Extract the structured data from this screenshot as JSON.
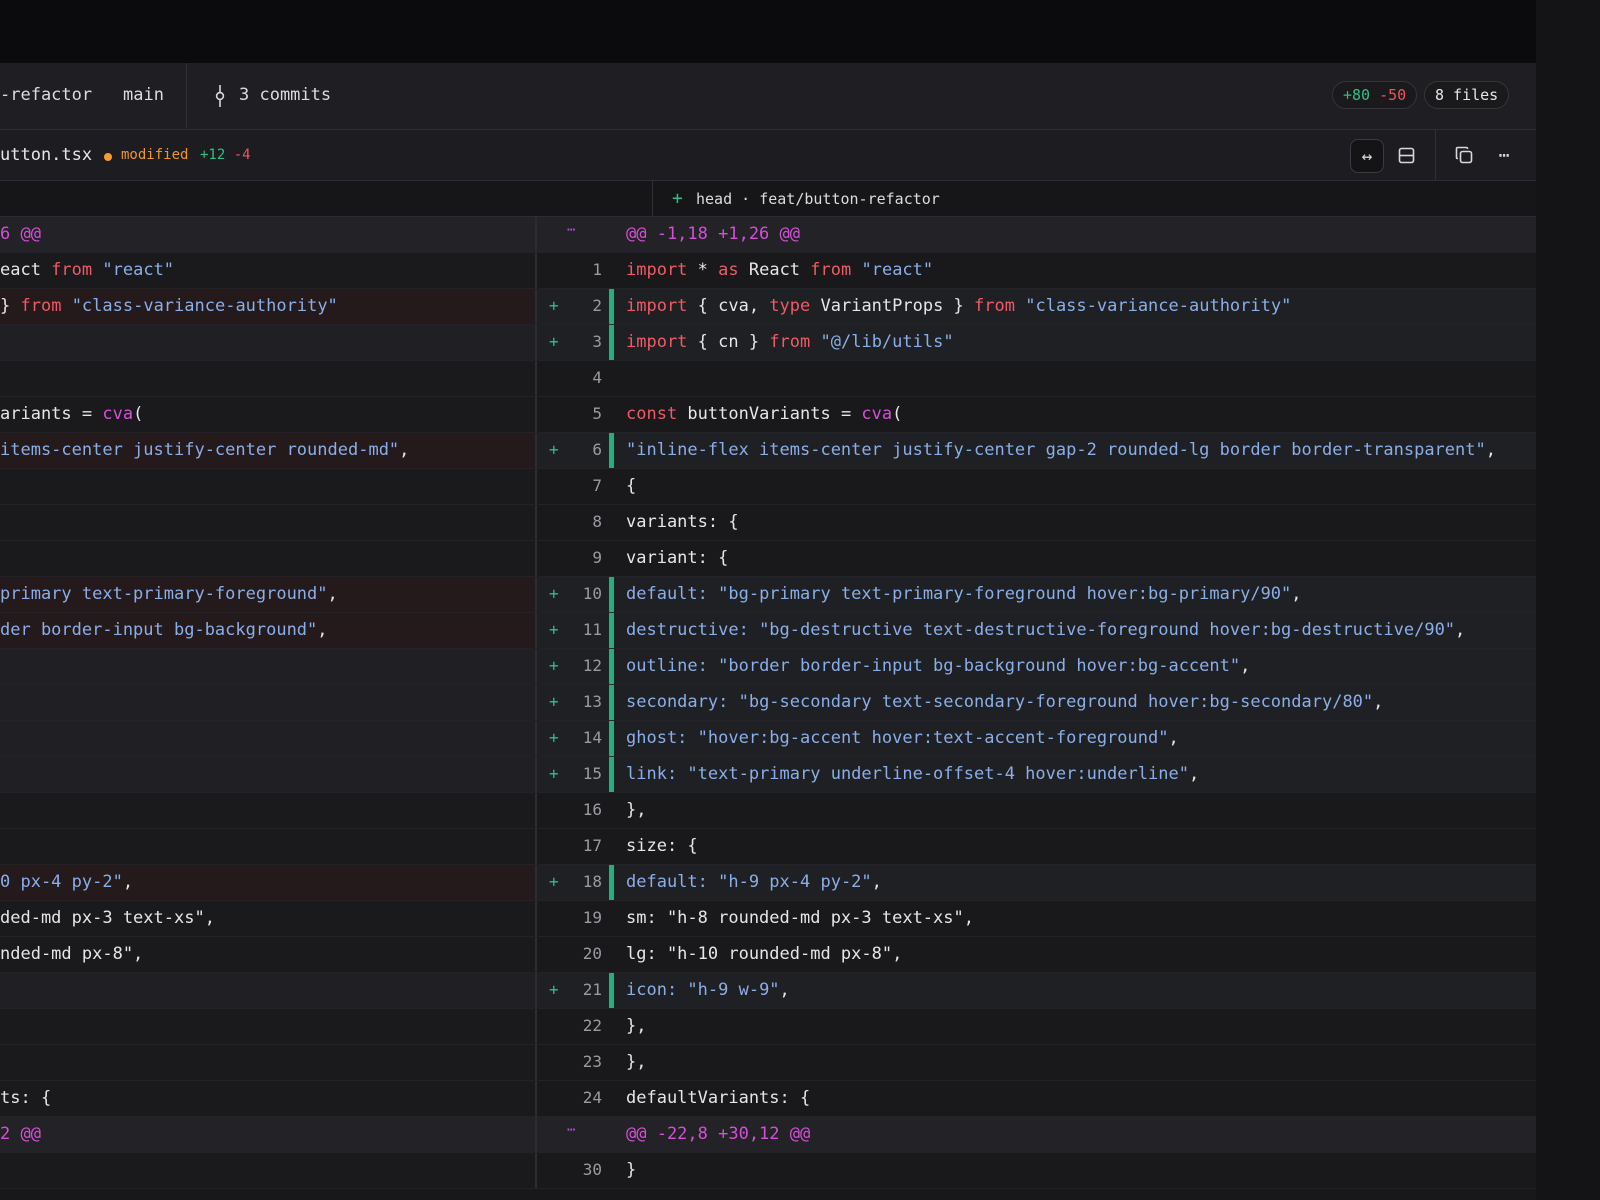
{
  "topbar": {
    "branch_from": "-refactor",
    "branch_to": "main",
    "commits_label": "3 commits",
    "additions": "+80",
    "deletions": "-50",
    "files_label": "8 files"
  },
  "file": {
    "name": "utton.tsx",
    "status": "modified",
    "additions": "+12",
    "deletions": "-4",
    "icons": [
      "split-view-icon",
      "unified-view-icon",
      "copy-icon",
      "more-icon"
    ]
  },
  "column_header": {
    "right_label": "head · feat/button-refactor"
  },
  "colors": {
    "addition": "#2fbf83",
    "deletion": "#f0535d",
    "modified": "#f0961f",
    "hunk": "#d64fd9",
    "keyword": "#ef5a66",
    "string": "#8aaee8"
  },
  "rows": [
    {
      "type": "hunk",
      "left": [
        [
          "6 @@",
          "hk"
        ]
      ],
      "marker": "⋯",
      "right": [
        [
          "@@ -1,18 +1,26 @@",
          "hk"
        ]
      ]
    },
    {
      "num": "1",
      "left": [
        [
          "eact ",
          ""
        ],
        [
          "from",
          "kw"
        ],
        [
          " ",
          ""
        ],
        [
          "\"react\"",
          "str"
        ]
      ],
      "right": [
        [
          "import",
          "kw"
        ],
        [
          " * ",
          ""
        ],
        [
          "as",
          "kw"
        ],
        [
          " React ",
          ""
        ],
        [
          "from",
          "kw"
        ],
        [
          " ",
          ""
        ],
        [
          "\"react\"",
          "str"
        ]
      ]
    },
    {
      "num": "2",
      "add": true,
      "ldel": true,
      "left": [
        [
          "} ",
          ""
        ],
        [
          "from",
          "kw"
        ],
        [
          " ",
          ""
        ],
        [
          "\"class-variance-authority\"",
          "str"
        ]
      ],
      "right": [
        [
          "import",
          "kw"
        ],
        [
          " { cva, ",
          ""
        ],
        [
          "type",
          "kw"
        ],
        [
          " VariantProps } ",
          ""
        ],
        [
          "from",
          "kw"
        ],
        [
          " ",
          ""
        ],
        [
          "\"class-variance-authority\"",
          "str"
        ]
      ]
    },
    {
      "num": "3",
      "add": true,
      "lempty": true,
      "left": [],
      "right": [
        [
          "import",
          "kw"
        ],
        [
          " { cn } ",
          ""
        ],
        [
          "from",
          "kw"
        ],
        [
          " ",
          ""
        ],
        [
          "\"@/lib/utils\"",
          "str"
        ]
      ]
    },
    {
      "num": "4",
      "left": [],
      "right": []
    },
    {
      "num": "5",
      "left": [
        [
          "ariants = ",
          ""
        ],
        [
          "cva",
          "fn"
        ],
        [
          "(",
          ""
        ]
      ],
      "right": [
        [
          "const",
          "kw"
        ],
        [
          " buttonVariants = ",
          ""
        ],
        [
          "cva",
          "fn"
        ],
        [
          "(",
          ""
        ]
      ]
    },
    {
      "num": "6",
      "add": true,
      "ldel": true,
      "left": [
        [
          "items-center justify-center rounded-md\"",
          "str"
        ],
        [
          ",",
          ""
        ]
      ],
      "right": [
        [
          "\"inline-flex items-center justify-center gap-2 rounded-lg border border-transparent\"",
          "str"
        ],
        [
          ",",
          ""
        ]
      ]
    },
    {
      "num": "7",
      "left": [],
      "right": [
        [
          "{",
          ""
        ]
      ]
    },
    {
      "num": "8",
      "left": [],
      "right": [
        [
          "variants: {",
          ""
        ]
      ]
    },
    {
      "num": "9",
      "left": [],
      "right": [
        [
          "variant: {",
          ""
        ]
      ]
    },
    {
      "num": "10",
      "add": true,
      "ldel": true,
      "left": [
        [
          "primary text-primary-foreground\"",
          "str"
        ],
        [
          ",",
          ""
        ]
      ],
      "right": [
        [
          "default: ",
          "str"
        ],
        [
          "\"bg-primary text-primary-foreground hover:bg-primary/90\"",
          "str"
        ],
        [
          ",",
          ""
        ]
      ]
    },
    {
      "num": "11",
      "add": true,
      "ldel": true,
      "left": [
        [
          "der border-input bg-background\"",
          "str"
        ],
        [
          ",",
          ""
        ]
      ],
      "right": [
        [
          "destructive: ",
          "str"
        ],
        [
          "\"bg-destructive text-destructive-foreground hover:bg-destructive/90\"",
          "str"
        ],
        [
          ",",
          ""
        ]
      ]
    },
    {
      "num": "12",
      "add": true,
      "lempty": true,
      "left": [],
      "right": [
        [
          "outline: ",
          "str"
        ],
        [
          "\"border border-input bg-background hover:bg-accent\"",
          "str"
        ],
        [
          ",",
          ""
        ]
      ]
    },
    {
      "num": "13",
      "add": true,
      "lempty": true,
      "left": [],
      "right": [
        [
          "secondary: ",
          "str"
        ],
        [
          "\"bg-secondary text-secondary-foreground hover:bg-secondary/80\"",
          "str"
        ],
        [
          ",",
          ""
        ]
      ]
    },
    {
      "num": "14",
      "add": true,
      "lempty": true,
      "left": [],
      "right": [
        [
          "ghost: ",
          "str"
        ],
        [
          "\"hover:bg-accent hover:text-accent-foreground\"",
          "str"
        ],
        [
          ",",
          ""
        ]
      ]
    },
    {
      "num": "15",
      "add": true,
      "lempty": true,
      "left": [],
      "right": [
        [
          "link: ",
          "str"
        ],
        [
          "\"text-primary underline-offset-4 hover:underline\"",
          "str"
        ],
        [
          ",",
          ""
        ]
      ]
    },
    {
      "num": "16",
      "left": [],
      "right": [
        [
          "},",
          ""
        ]
      ]
    },
    {
      "num": "17",
      "left": [],
      "right": [
        [
          "size: {",
          ""
        ]
      ]
    },
    {
      "num": "18",
      "add": true,
      "ldel": true,
      "left": [
        [
          "0 px-4 py-2\"",
          "str"
        ],
        [
          ",",
          ""
        ]
      ],
      "right": [
        [
          "default: ",
          "str"
        ],
        [
          "\"h-9 px-4 py-2\"",
          "str"
        ],
        [
          ",",
          ""
        ]
      ]
    },
    {
      "num": "19",
      "left": [
        [
          "ded-md px-3 text-xs\",",
          ""
        ]
      ],
      "right": [
        [
          "sm: \"h-8 rounded-md px-3 text-xs\",",
          ""
        ]
      ]
    },
    {
      "num": "20",
      "left": [
        [
          "nded-md px-8\",",
          ""
        ]
      ],
      "right": [
        [
          "lg: \"h-10 rounded-md px-8\",",
          ""
        ]
      ]
    },
    {
      "num": "21",
      "add": true,
      "lempty": true,
      "left": [],
      "right": [
        [
          "icon: ",
          "str"
        ],
        [
          "\"h-9 w-9\"",
          "str"
        ],
        [
          ",",
          ""
        ]
      ]
    },
    {
      "num": "22",
      "left": [],
      "right": [
        [
          "},",
          ""
        ]
      ]
    },
    {
      "num": "23",
      "left": [],
      "right": [
        [
          "},",
          ""
        ]
      ]
    },
    {
      "num": "24",
      "left": [
        [
          "ts: {",
          ""
        ]
      ],
      "right": [
        [
          "defaultVariants: {",
          ""
        ]
      ]
    },
    {
      "type": "hunk",
      "left": [
        [
          "2 @@",
          "hk"
        ]
      ],
      "marker": "⋯",
      "right": [
        [
          "@@ -22,8 +30,12 @@",
          "hk"
        ]
      ]
    },
    {
      "num": "30",
      "left": [],
      "right": [
        [
          "}",
          ""
        ]
      ]
    }
  ]
}
